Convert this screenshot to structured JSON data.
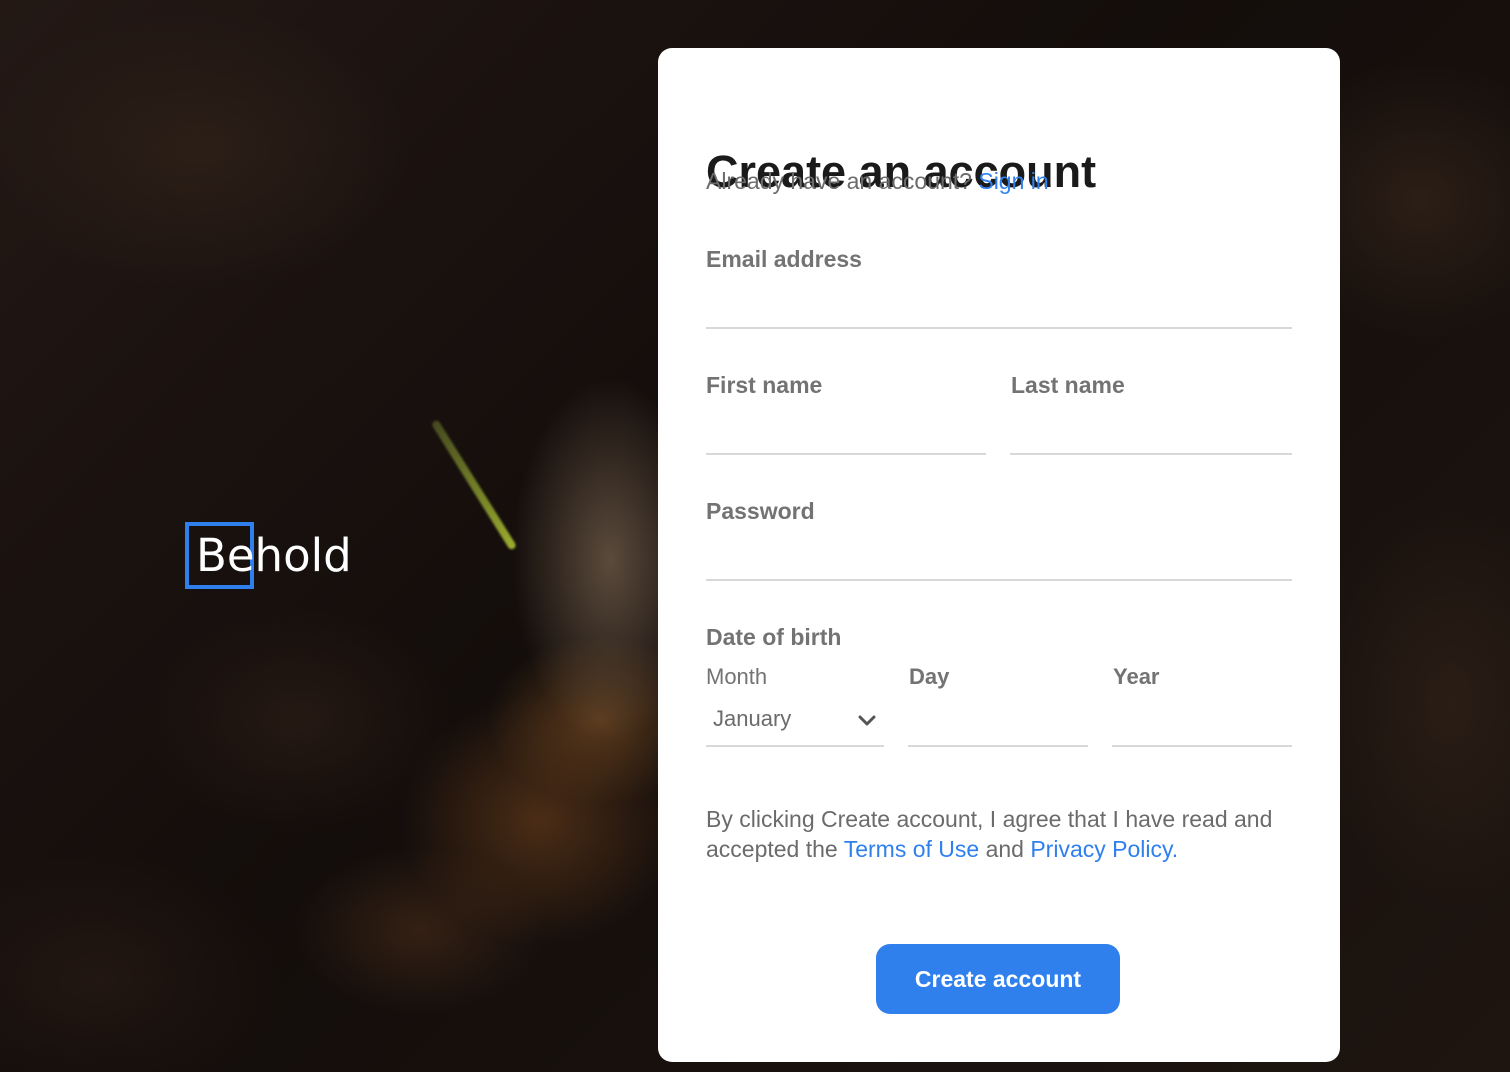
{
  "brand": {
    "logo_text": "Behold",
    "accent_color": "#2f80ed"
  },
  "form": {
    "title": "Create an account",
    "signin_prompt": "Already have an account?",
    "signin_link": "Sign in",
    "email_label": "Email address",
    "email_value": "",
    "first_name_label": "First name",
    "first_name_value": "",
    "last_name_label": "Last name",
    "last_name_value": "",
    "password_label": "Password",
    "password_value": "",
    "dob_label": "Date of birth",
    "month_label": "Month",
    "month_value": "January",
    "day_label": "Day",
    "day_value": "",
    "year_label": "Year",
    "year_value": "",
    "terms_prefix": "By clicking Create account, I agree that I have read and accepted the",
    "terms_link": "Terms of Use",
    "terms_and": "and",
    "privacy_link": "Privacy Policy",
    "terms_suffix": ".",
    "submit_label": "Create account"
  },
  "icons": {
    "month_dropdown": "chevron-down-icon"
  }
}
